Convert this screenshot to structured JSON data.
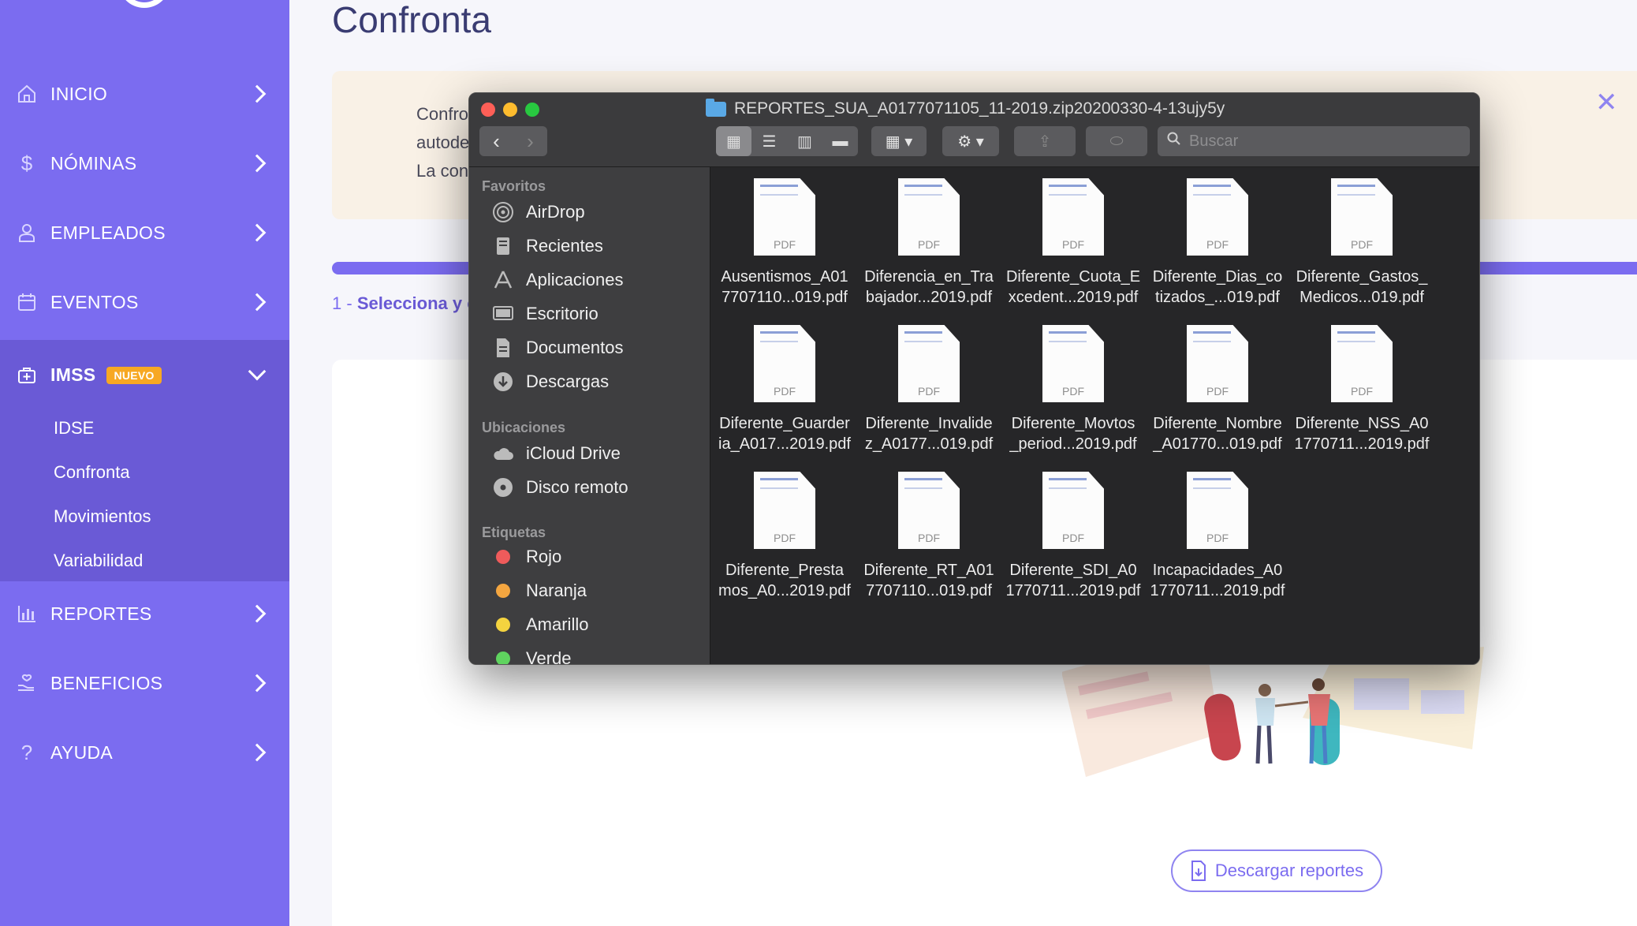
{
  "sidebar": {
    "items": [
      {
        "label": "INICIO",
        "icon": "home-icon"
      },
      {
        "label": "NÓMINAS",
        "icon": "dollar-icon"
      },
      {
        "label": "EMPLEADOS",
        "icon": "user-icon"
      },
      {
        "label": "EVENTOS",
        "icon": "calendar-icon"
      },
      {
        "label": "IMSS",
        "icon": "medical-icon",
        "badge": "NUEVO"
      },
      {
        "label": "REPORTES",
        "icon": "bar-chart-icon"
      },
      {
        "label": "BENEFICIOS",
        "icon": "hand-heart-icon"
      },
      {
        "label": "AYUDA",
        "icon": "question-icon"
      }
    ],
    "imss_sub": [
      "IDSE",
      "Confronta",
      "Movimientos",
      "Variabilidad"
    ]
  },
  "main": {
    "title": "Confronta",
    "banner_lines": [
      "Confronta e",
      "autoderemi",
      "La confronta"
    ],
    "step": {
      "number": "1 -",
      "text": "Selecciona y c"
    },
    "download_button": "Descargar reportes"
  },
  "finder": {
    "title": "REPORTES_SUA_A0177071105_11-2019.zip20200330-4-13ujy5y",
    "search_placeholder": "Buscar",
    "sections": {
      "favoritos": {
        "header": "Favoritos",
        "items": [
          {
            "label": "AirDrop",
            "icon": "airdrop-icon"
          },
          {
            "label": "Recientes",
            "icon": "recents-icon"
          },
          {
            "label": "Aplicaciones",
            "icon": "applications-icon"
          },
          {
            "label": "Escritorio",
            "icon": "desktop-icon"
          },
          {
            "label": "Documentos",
            "icon": "documents-icon"
          },
          {
            "label": "Descargas",
            "icon": "downloads-icon"
          }
        ]
      },
      "ubicaciones": {
        "header": "Ubicaciones",
        "items": [
          {
            "label": "iCloud Drive",
            "icon": "cloud-icon"
          },
          {
            "label": "Disco remoto",
            "icon": "disc-icon"
          }
        ]
      },
      "etiquetas": {
        "header": "Etiquetas",
        "items": [
          {
            "label": "Rojo",
            "color": "#ef5b5b"
          },
          {
            "label": "Naranja",
            "color": "#f4a640"
          },
          {
            "label": "Amarillo",
            "color": "#f4d33f"
          },
          {
            "label": "Verde",
            "color": "#5fd35f"
          }
        ]
      }
    },
    "files": [
      {
        "line1": "Ausentismos_A01",
        "line2": "7707110...019.pdf"
      },
      {
        "line1": "Diferencia_en_Tra",
        "line2": "bajador...2019.pdf"
      },
      {
        "line1": "Diferente_Cuota_E",
        "line2": "xcedent...2019.pdf"
      },
      {
        "line1": "Diferente_Dias_co",
        "line2": "tizados_...019.pdf"
      },
      {
        "line1": "Diferente_Gastos_",
        "line2": "Medicos...019.pdf"
      },
      {
        "line1": "Diferente_Guarder",
        "line2": "ia_A017...2019.pdf"
      },
      {
        "line1": "Diferente_Invalide",
        "line2": "z_A0177...019.pdf"
      },
      {
        "line1": "Diferente_Movtos",
        "line2": "_period...2019.pdf"
      },
      {
        "line1": "Diferente_Nombre",
        "line2": "_A01770...019.pdf"
      },
      {
        "line1": "Diferente_NSS_A0",
        "line2": "1770711...2019.pdf"
      },
      {
        "line1": "Diferente_Presta",
        "line2": "mos_A0...2019.pdf"
      },
      {
        "line1": "Diferente_RT_A01",
        "line2": "7707110...019.pdf"
      },
      {
        "line1": "Diferente_SDI_A0",
        "line2": "1770711...2019.pdf"
      },
      {
        "line1": "Incapacidades_A0",
        "line2": "1770711...2019.pdf"
      }
    ],
    "file_type_label": "PDF"
  },
  "colors": {
    "sidebar": "#7b6cf0",
    "sidebar_active": "#6a5ad6",
    "badge": "#f7a823",
    "title": "#3a3c72"
  }
}
